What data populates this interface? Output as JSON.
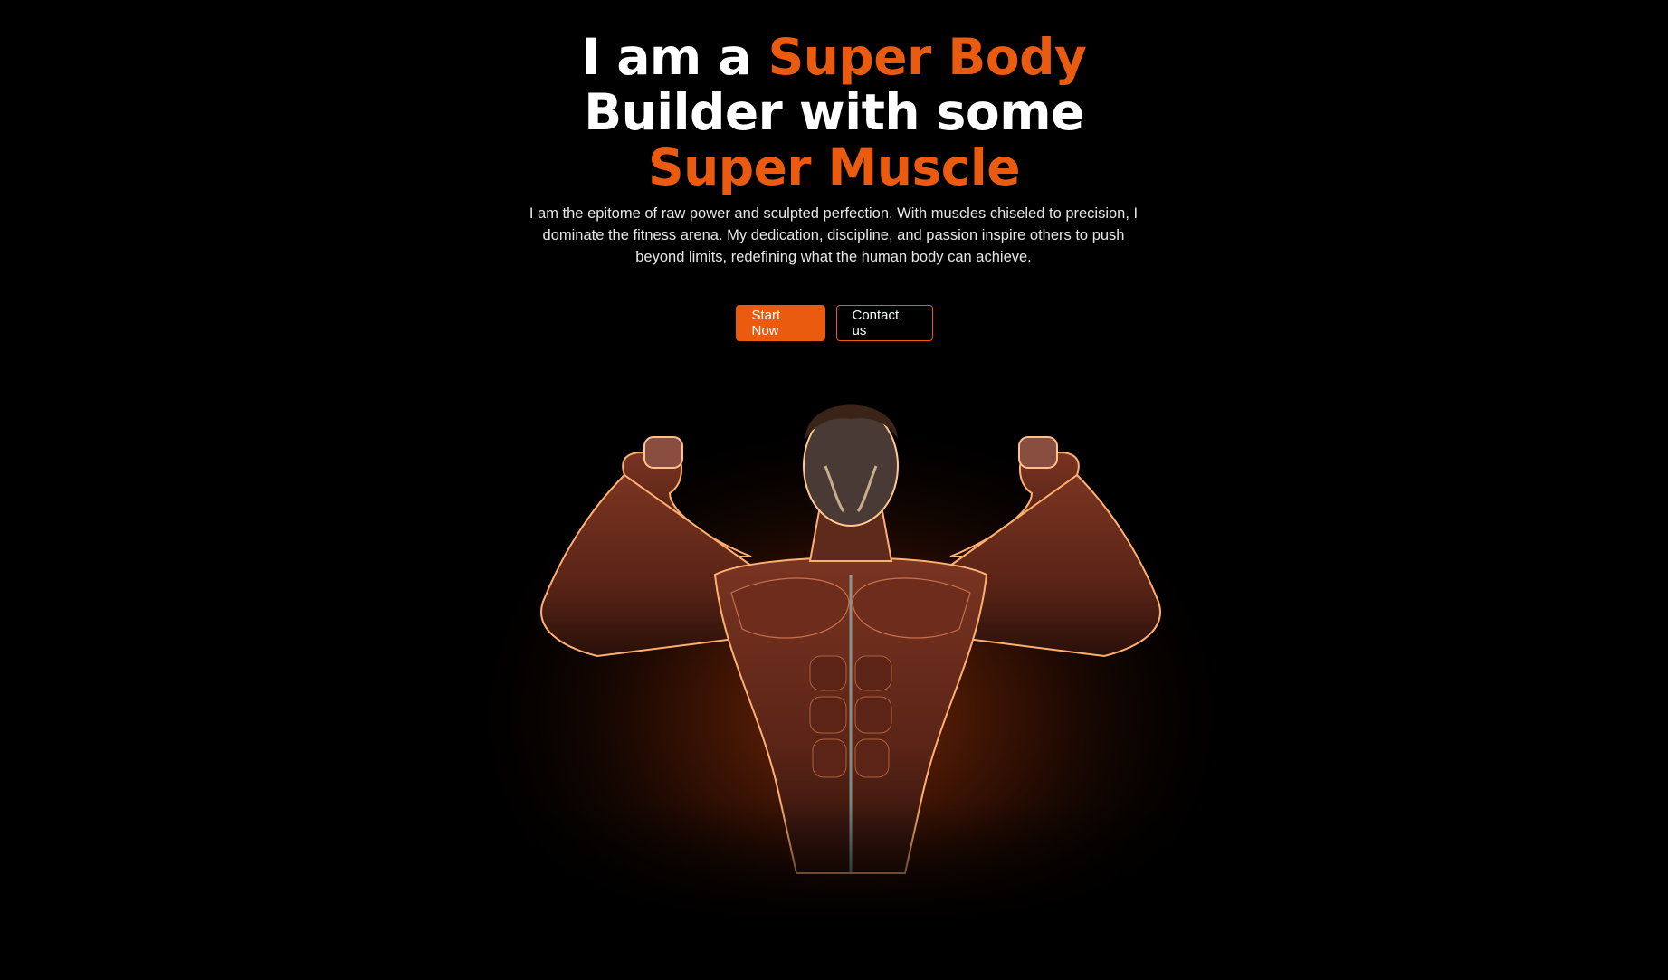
{
  "hero": {
    "headline": {
      "line1_white": "I am a ",
      "line1_accent": "Super Body",
      "line2_white": "Builder with some",
      "line3_accent": "Super Muscle"
    },
    "description": "I am the epitome of raw power and sculpted perfection. With muscles chiseled to precision, I dominate the fitness arena. My dedication, discipline, and passion inspire others to push beyond limits, redefining what the human body can achieve.",
    "buttons": {
      "start_label": "Start Now",
      "contact_label": "Contact us"
    },
    "image": {
      "subject": "bodybuilder flexing both biceps with orange rim light"
    }
  },
  "colors": {
    "background": "#000000",
    "accent": "#ea5b10",
    "text": "#ffffff"
  }
}
